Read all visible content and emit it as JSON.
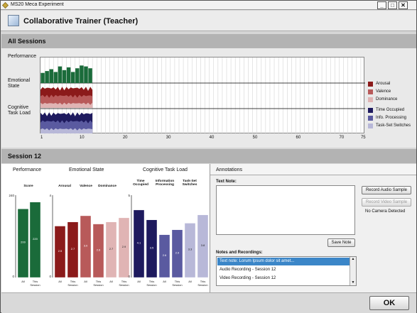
{
  "window": {
    "title": "MS20 Meca Experiment",
    "minimize": "_",
    "maximize": "□",
    "close": "✕"
  },
  "header": {
    "title": "Collaborative Trainer (Teacher)"
  },
  "all_sessions": {
    "title": "All Sessions",
    "rows": {
      "performance": "Performance",
      "emotional": "Emotional State",
      "cognitive": "Cognitive Task Load"
    },
    "x_ticks": [
      "1",
      "10",
      "20",
      "30",
      "40",
      "50",
      "60",
      "70",
      "75"
    ],
    "legend": [
      {
        "label": "Arousal",
        "color": "#8b1a1a"
      },
      {
        "label": "Valence",
        "color": "#b85a5a"
      },
      {
        "label": "Dominance",
        "color": "#e0b4b4"
      },
      {
        "label": "Time Occupied",
        "color": "#1e1a5e"
      },
      {
        "label": "Info. Processing",
        "color": "#5a5aa0"
      },
      {
        "label": "Task-Set Switches",
        "color": "#b8b8d8"
      }
    ]
  },
  "session": {
    "title": "Session 12",
    "performance_label": "Performance",
    "emotional_label": "Emotional State",
    "cognitive_label": "Cognitive Task Load"
  },
  "chart_data": [
    {
      "type": "bar",
      "title": "Score",
      "categories": [
        "All",
        "This Session"
      ],
      "values": [
        200,
        220
      ],
      "ylim": [
        0,
        240
      ],
      "y_ticks": [
        "240",
        "0"
      ],
      "colors": [
        "#1a6b3a",
        "#1a6b3a"
      ]
    },
    {
      "type": "bar",
      "categories": [
        "All",
        "This Session",
        "All",
        "This Session",
        "All",
        "This Session"
      ],
      "groups": [
        "Arousal",
        "Valence",
        "Dominance"
      ],
      "values": [
        2.5,
        2.7,
        3.0,
        2.6,
        2.7,
        2.9
      ],
      "labels": [
        "2.5",
        "2.7",
        "3.0",
        "2.6",
        "2.7",
        "2.9"
      ],
      "ylim": [
        0,
        4
      ],
      "y_ticks": [
        "4",
        "0"
      ],
      "colors": [
        "#8b1a1a",
        "#8b1a1a",
        "#b85a5a",
        "#b85a5a",
        "#e0b4b4",
        "#e0b4b4"
      ]
    },
    {
      "type": "bar",
      "categories": [
        "All",
        "This Session",
        "All",
        "This Session",
        "All",
        "This Session"
      ],
      "groups": [
        "Time Occupied",
        "Information Processing",
        "Task-Set Switches"
      ],
      "values": [
        4.1,
        3.5,
        2.6,
        2.9,
        3.3,
        3.8
      ],
      "labels": [
        "4.1",
        "3.5",
        "2.6",
        "2.9",
        "3.3",
        "3.8"
      ],
      "ylim": [
        0,
        5
      ],
      "y_ticks": [
        "5",
        "0"
      ],
      "colors": [
        "#1e1a5e",
        "#1e1a5e",
        "#5a5aa0",
        "#5a5aa0",
        "#b8b8d8",
        "#b8b8d8"
      ]
    }
  ],
  "annotations": {
    "title": "Annotations",
    "text_note_label": "Text Note:",
    "record_audio": "Record Audio Sample",
    "record_video": "Record Video Sample",
    "no_camera": "No Camera Detected",
    "save_note": "Save Note",
    "notes_label": "Notes and Recordings:",
    "items": [
      "Text note: Lorum Ipsum dolor sit amet...",
      "Audio Recording - Session 12",
      "Video Recording - Session 12"
    ]
  },
  "footer": {
    "ok": "OK"
  }
}
